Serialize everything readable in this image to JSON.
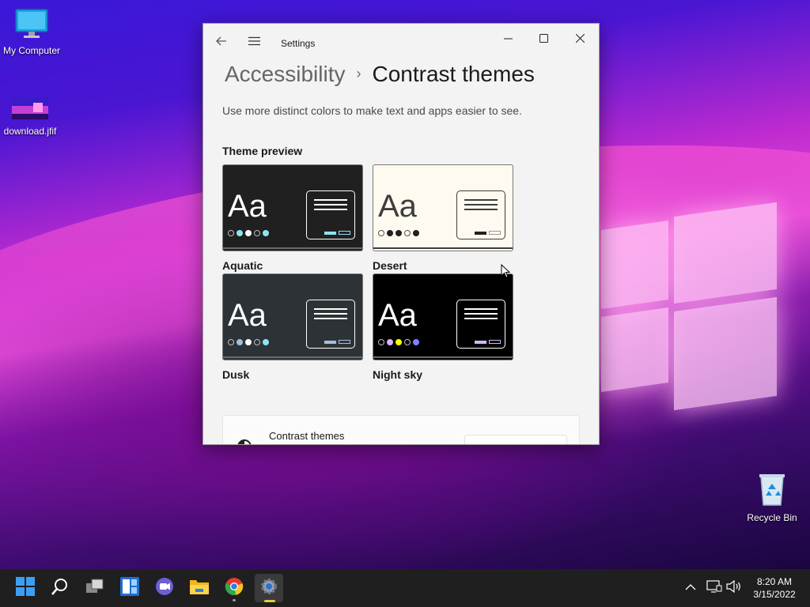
{
  "desktop": {
    "icons": [
      {
        "label": "My Computer"
      },
      {
        "label": "download.jfif"
      },
      {
        "label": "Recycle Bin"
      }
    ]
  },
  "window": {
    "app_title": "Settings",
    "breadcrumb": {
      "parent": "Accessibility",
      "separator": "›",
      "current": "Contrast themes"
    },
    "description": "Use more distinct colors to make text and apps easier to see.",
    "section_label": "Theme preview",
    "themes": [
      {
        "name": "Aquatic",
        "sample": "Aa",
        "bg": "#202020",
        "fg": "#ffffff",
        "accent": "#8ee3f0"
      },
      {
        "name": "Desert",
        "sample": "Aa",
        "bg": "#fffaef",
        "fg": "#3d3d3d",
        "accent": "#202020"
      },
      {
        "name": "Dusk",
        "sample": "Aa",
        "bg": "#2d3236",
        "fg": "#ffffff",
        "accent": "#a1bfde"
      },
      {
        "name": "Night sky",
        "sample": "Aa",
        "bg": "#000000",
        "fg": "#ffffff",
        "accent": "#d6b4fd"
      }
    ],
    "bottom_card": {
      "label": "Contrast themes"
    }
  },
  "taskbar": {
    "apps": [
      "start",
      "search",
      "task-view",
      "widgets",
      "chat",
      "file-explorer",
      "chrome",
      "settings"
    ],
    "clock": {
      "time": "8:20 AM",
      "date": "3/15/2022"
    }
  }
}
